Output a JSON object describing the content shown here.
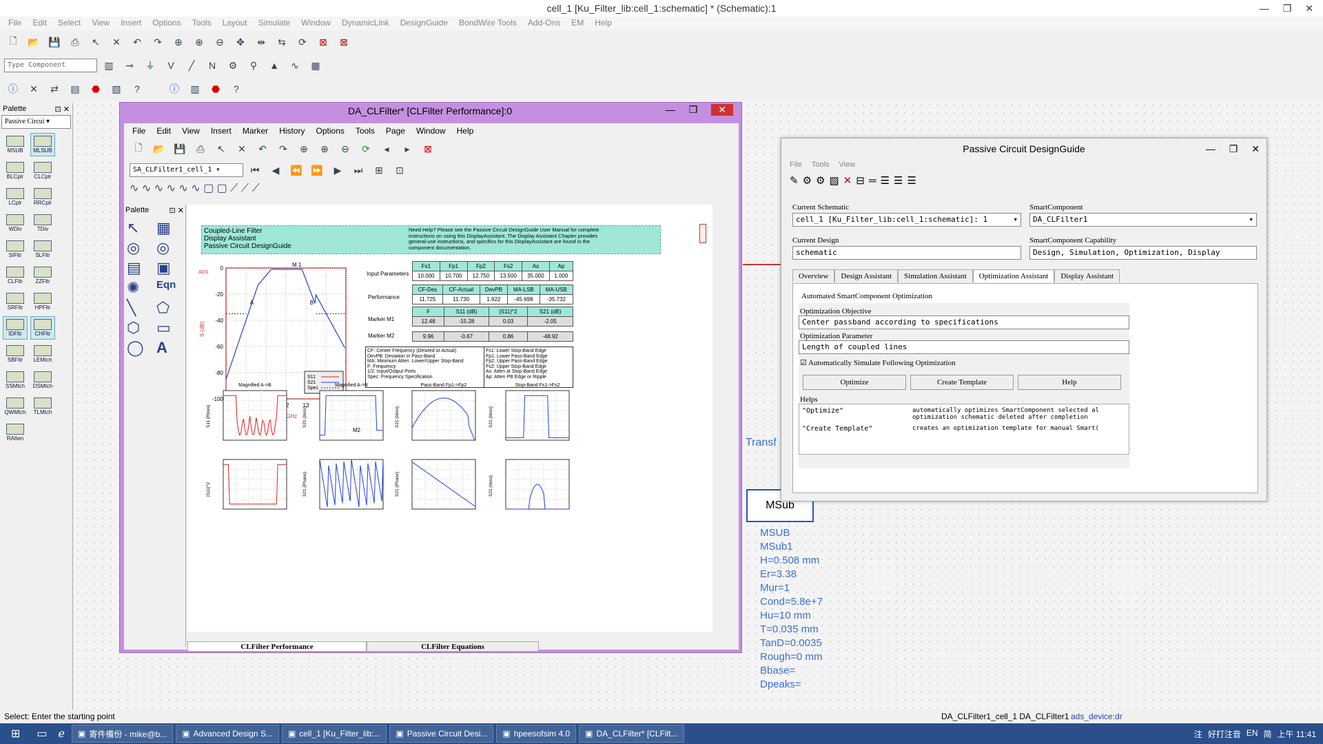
{
  "main": {
    "title": "cell_1 [Ku_Filter_lib:cell_1:schematic] * (Schematic):1",
    "menu": [
      "File",
      "Edit",
      "Select",
      "View",
      "Insert",
      "Options",
      "Tools",
      "Layout",
      "Simulate",
      "Window",
      "DynamicLink",
      "DesignGuide",
      "BondWire Tools",
      "Add-Ons",
      "EM",
      "Help"
    ],
    "type_component_placeholder": "Type Component",
    "status": "Select: Enter the starting point",
    "status_right": "DA_CLFilter1_cell_1 DA_CLFilter1",
    "status_link": "ads_device:dr"
  },
  "palette": {
    "title": "Palette",
    "category": "Passive Circui",
    "items": [
      "MSUB",
      "MLSUB",
      "BLCplr",
      "CLCplr",
      "LCplr",
      "RRCplr",
      "WDiv",
      "TDiv",
      "SIFltr",
      "SLFltr",
      "CLFltr",
      "ZZFltr",
      "SRFltr",
      "HPFltr",
      "IDFltr",
      "CHFltr",
      "SBFltr",
      "LEMtch",
      "SSMtch",
      "DSMtch",
      "QWMtch",
      "TLMtch",
      "RAtten"
    ]
  },
  "da": {
    "title": "DA_CLFilter* [CLFilter Performance]:0",
    "menu": [
      "File",
      "Edit",
      "View",
      "Insert",
      "Marker",
      "History",
      "Options",
      "Tools",
      "Page",
      "Window",
      "Help"
    ],
    "combo": "SA_CLFilter1_cell_1",
    "palette_title": "Palette",
    "tabs": [
      "CLFilter Performance",
      "CLFilter Equations"
    ],
    "header_lines": [
      "Coupled-Line Filter",
      "Display Assistant",
      "Passive Circuit DesignGuide"
    ],
    "help_text": "Need Help? Please see the Passive Circuit DesignGuide User Manual for complete instructions on using this DisplayAssistant. The Display Assistant Chapter provides general-use instructions, and specifics for this DisplayAssistant are found in the component documentation.",
    "input_params_label": "Input Parameters",
    "performance_label": "Performance",
    "marker1_label": "Marker M1",
    "marker2_label": "Marker M2",
    "input_headers": [
      "Fs1",
      "Fp1",
      "Fp2",
      "Fs2",
      "As",
      "Ap"
    ],
    "input_values": [
      "10.000",
      "10.700",
      "12.750",
      "13.500",
      "35.000",
      "1.000"
    ],
    "perf_headers": [
      "CF-Des",
      "CF-Actual",
      "DevPB",
      "MA-LSB",
      "MA-USB"
    ],
    "perf_values": [
      "11.725",
      "11.730",
      "1.922",
      "-45.698",
      "-35.732"
    ],
    "marker_headers": [
      "F",
      "S11 (dB)",
      "|S11|^2",
      "S21 (dB)"
    ],
    "m1_values": [
      "12.48",
      "-15.28",
      "0.03",
      "-2.05"
    ],
    "m2_values": [
      "9.96",
      "-0.67",
      "0.86",
      "-48.92"
    ],
    "legend_left": [
      "CF: Center Frequency (Desired or Actual)",
      "DevPB: Deviation in Pass-Band",
      "MA: Minimum Atten. Lower/Upper Stop-Band",
      "F: Frequency",
      "1/2: Input/Output Ports",
      "Spec: Frequency Specification"
    ],
    "legend_right": [
      "Fs1: Lower Stop-Band Edge",
      "Fp1: Lower Pass-Band Edge",
      "Fp2: Upper Pass-Band Edge",
      "Fs2: Upper Stop-Band Edge",
      "As: Atten at Stop-Band Edge",
      "Ap: Atten PB Edge or Ripple"
    ],
    "main_plot": {
      "ylabel": "S (dB)",
      "xlabel": "freq, GHz",
      "marker": "M 1",
      "legend": [
        "S11",
        "S21",
        "Spec"
      ],
      "ads": "ADS",
      "yticks": [
        "0",
        "-20",
        "-40",
        "-60",
        "-80",
        "-100"
      ],
      "xticks": [
        "9",
        "10",
        "11",
        "12",
        "13",
        "14",
        "15"
      ],
      "labelA": "A",
      "labelB": "B"
    },
    "small_titles": [
      "Magnified A->B",
      "Magnified A->B",
      "Pass-Band Fp1->Fp2",
      "Stop-Band Fs1->Fs2"
    ],
    "small_ylabels": [
      "S11 (Rloss)",
      "S21 (Iloss)",
      "S21 (Iloss)",
      "S21 (Iloss)",
      "|S11|^2",
      "S21 (Phase)",
      "S21 (Phase)",
      "S21 (Iloss)"
    ],
    "m2_label": "M2"
  },
  "dg": {
    "title": "Passive Circuit DesignGuide",
    "menu": [
      "File",
      "Tools",
      "View"
    ],
    "cur_schematic_label": "Current Schematic",
    "cur_schematic": "cell_1 [Ku_Filter_lib:cell_1:schematic]: 1",
    "smart_label": "SmartComponent",
    "smart": "DA_CLFilter1",
    "cur_design_label": "Current Design",
    "cur_design": "schematic",
    "cap_label": "SmartComponent Capability",
    "cap": "Design, Simulation, Optimization, Display",
    "tabs": [
      "Overview",
      "Design Assistant",
      "Simulation Assistant",
      "Optimization Assistant",
      "Display Assistant"
    ],
    "section": "Automated SmartComponent Optimization",
    "obj_label": "Optimization Objective",
    "obj": "Center passband according to specifications",
    "param_label": "Optimization Parameter",
    "param": "Length of coupled lines",
    "auto_sim": "Automatically Simulate Following Optimization",
    "buttons": [
      "Optimize",
      "Create Template",
      "Help"
    ],
    "helps_label": "Helps",
    "helps": [
      {
        "k": "\"Optimize\"",
        "v": "automatically optimizes SmartComponent selected al optimization schematic deleted after completion"
      },
      {
        "k": "\"Create Template\"",
        "v": "creates an optimization template for manual Smart("
      }
    ]
  },
  "schem": {
    "transf": "Transf",
    "msub_box": "MSub",
    "msub_lines": [
      "MSUB",
      "MSub1",
      "H=0.508 mm",
      "Er=3.38",
      "Mur=1",
      "Cond=5.8e+7",
      "Hu=10 mm",
      "T=0.035 mm",
      "TanD=0.0035",
      "Rough=0 mm",
      "Bbase=",
      "Dpeaks="
    ]
  },
  "taskbar": {
    "items": [
      "寄件備份 - mike@b...",
      "Advanced Design S...",
      "cell_1 [Ku_Filter_lib:...",
      "Passive Circuit Desi...",
      "hpeesofsim 4.0",
      "DA_CLFilter* [CLFilt..."
    ],
    "tray": [
      "注",
      "好打注音",
      "EN",
      "简"
    ],
    "clock": "上午 11:41"
  },
  "colors": {
    "da_frame": "#c58fe0",
    "s11": "#e02020",
    "s21": "#2040e0",
    "teal": "#9fe8d8"
  }
}
